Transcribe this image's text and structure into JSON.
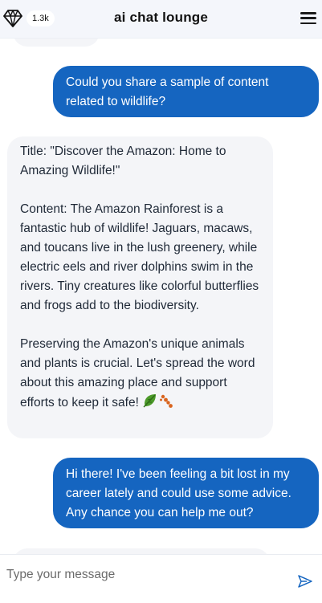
{
  "header": {
    "title": "ai chat lounge",
    "count_badge": "1.3k",
    "logo_icon": "diamond-gem-icon",
    "menu_icon": "hamburger-menu-icon"
  },
  "messages": [
    {
      "role": "user",
      "text": "Could you share a sample of content related to wildlife?"
    },
    {
      "role": "assistant",
      "text": "Title: \"Discover the Amazon: Home to Amazing Wildlife!\"\n\nContent: The Amazon Rainforest is a fantastic hub of wildlife! Jaguars, macaws, and toucans live in the lush greenery, while electric eels and river dolphins swim in the rivers. Tiny creatures like colorful butterflies and frogs add to the biodiversity.\n\nPreserving the Amazon's unique animals and plants is crucial. Let's spread the word about this amazing place and support efforts to keep it safe!",
      "trailing_icons": [
        "leaf-icon",
        "paw-prints-icon"
      ]
    },
    {
      "role": "user",
      "text": "Hi there! I've been feeling a bit lost in my career lately and could use some advice. Any chance you can help me out?"
    }
  ],
  "composer": {
    "placeholder": "Type your message",
    "send_icon": "send-icon"
  },
  "colors": {
    "user_bubble": "#1565c0",
    "assistant_bubble": "#f4f5f8",
    "header_bg": "#f4f6fb"
  }
}
